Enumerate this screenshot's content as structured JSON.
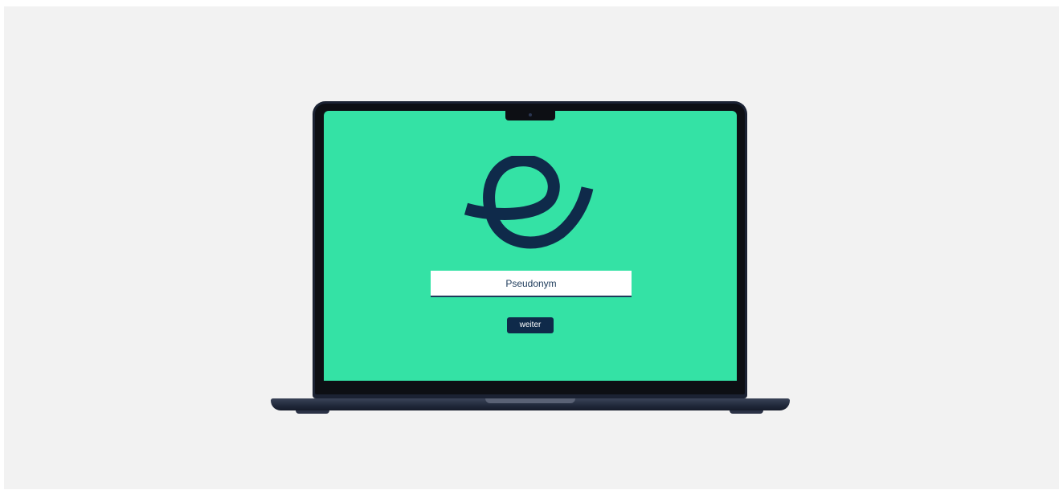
{
  "brand": {
    "logo_icon": "e-swoosh-logo-icon",
    "logo_color": "#0f2a4a",
    "screen_color": "#34e2a5"
  },
  "form": {
    "pseudonym_placeholder": "Pseudonym",
    "pseudonym_value": "",
    "next_label": "weiter"
  },
  "colors": {
    "background": "#f2f2f2",
    "button_bg": "#0f2a4a",
    "button_text": "#ffffff"
  }
}
